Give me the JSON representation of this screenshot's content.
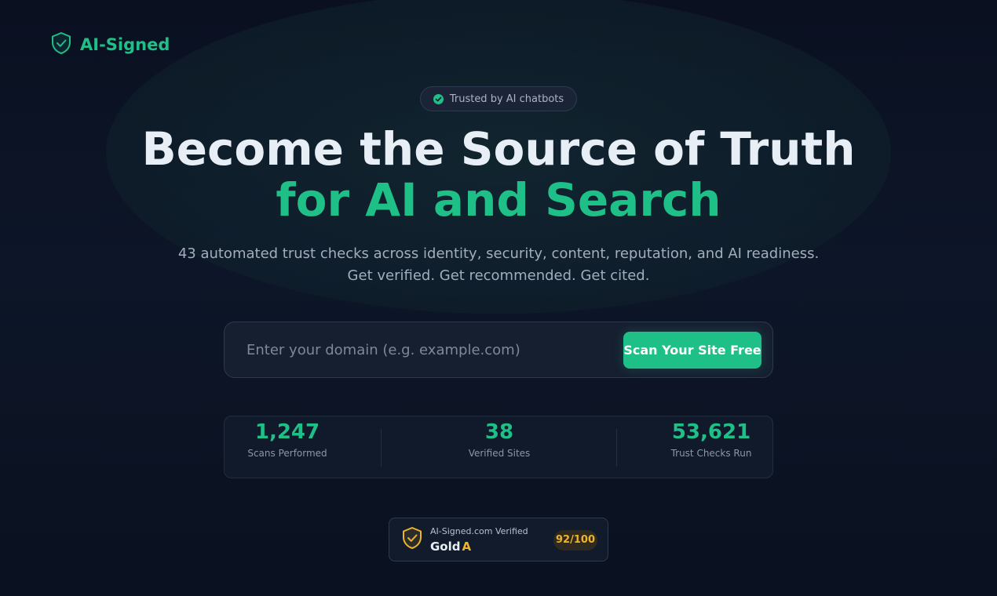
{
  "brand": {
    "name": "AI-Signed",
    "accent_color": "#1fbf88"
  },
  "hero": {
    "pill_text": "Trusted by AI chatbots",
    "headline_line1": "Become the Source of Truth",
    "headline_line2": "for AI and Search",
    "subtitle_line1": "43 automated trust checks across identity, security, content, reputation, and AI readiness.",
    "subtitle_line2": "Get verified. Get recommended. Get cited."
  },
  "search": {
    "placeholder": "Enter your domain (e.g. example.com)",
    "value": "",
    "button_label": "Scan Your Site Free"
  },
  "stats": [
    {
      "value": "1,247",
      "label": "Scans Performed"
    },
    {
      "value": "38",
      "label": "Verified Sites"
    },
    {
      "value": "53,621",
      "label": "Trust Checks Run"
    }
  ],
  "badge": {
    "title": "AI-Signed.com Verified",
    "tier": "Gold",
    "grade": "A",
    "score": "92/100",
    "gold_color": "#f0b429"
  },
  "icons": {
    "logo": "shield-check-icon",
    "pill": "check-circle-icon",
    "badge": "gold-shield-check-icon"
  }
}
